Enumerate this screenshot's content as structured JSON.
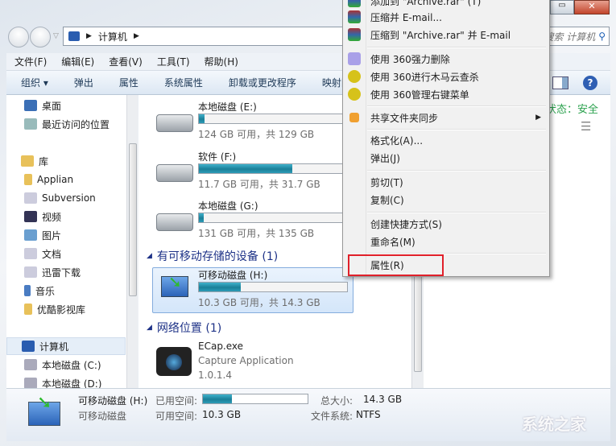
{
  "nav": {
    "breadcrumb": [
      "计算机"
    ],
    "search_placeholder": "搜索 计算机"
  },
  "menubar": [
    "文件(F)",
    "编辑(E)",
    "查看(V)",
    "工具(T)",
    "帮助(H)"
  ],
  "toolbar": [
    "组织 ▾",
    "弹出",
    "属性",
    "系统属性",
    "卸载或更改程序",
    "映射网"
  ],
  "sidebar": {
    "items": [
      {
        "label": "桌面",
        "icon": "desktop-icon"
      },
      {
        "label": "最近访问的位置",
        "icon": "recent-icon"
      },
      {
        "label": "库",
        "icon": "library-icon"
      },
      {
        "label": "Applian",
        "icon": "folder-icon"
      },
      {
        "label": "Subversion",
        "icon": "document-icon"
      },
      {
        "label": "视频",
        "icon": "video-icon"
      },
      {
        "label": "图片",
        "icon": "picture-icon"
      },
      {
        "label": "文档",
        "icon": "document-icon"
      },
      {
        "label": "迅雷下载",
        "icon": "document-icon"
      },
      {
        "label": "音乐",
        "icon": "music-icon"
      },
      {
        "label": "优酷影视库",
        "icon": "folder-icon"
      },
      {
        "label": "计算机",
        "icon": "computer-icon"
      },
      {
        "label": "本地磁盘 (C:)",
        "icon": "drive-icon"
      },
      {
        "label": "本地磁盘 (D:)",
        "icon": "drive-icon"
      }
    ]
  },
  "drives": [
    {
      "name": "本地磁盘 (E:)",
      "info": "124 GB 可用，共 129 GB",
      "used_fraction": 0.04
    },
    {
      "name": "软件 (F:)",
      "info": "11.7 GB 可用，共 31.7 GB",
      "used_fraction": 0.63
    },
    {
      "name": "本地磁盘 (G:)",
      "info": "131 GB 可用，共 135 GB",
      "used_fraction": 0.03
    }
  ],
  "removable_group": "有可移动存储的设备 (1)",
  "removable": {
    "name": "可移动磁盘 (H:)",
    "info": "10.3 GB 可用，共 14.3 GB",
    "used_fraction": 0.28
  },
  "network_group": "网络位置 (1)",
  "network": {
    "name": "ECap.exe",
    "desc": "Capture Application",
    "version": "1.0.1.4"
  },
  "right": {
    "status": "状态：安全"
  },
  "context_menu": {
    "items": [
      "添加到 \"Archive.rar\" (T)",
      "压缩并 E-mail...",
      "压缩到 \"Archive.rar\" 并 E-mail",
      "使用 360强力删除",
      "使用 360进行木马云查杀",
      "使用 360管理右键菜单",
      "共享文件夹同步",
      "格式化(A)...",
      "弹出(J)",
      "剪切(T)",
      "复制(C)",
      "创建快捷方式(S)",
      "重命名(M)",
      "属性(R)"
    ],
    "highlighted": "属性(R)",
    "highlight_color": "#e0202a"
  },
  "details": {
    "name": "可移动磁盘 (H:)",
    "type": "可移动磁盘",
    "used_label": "已用空间:",
    "free_label": "可用空间:",
    "free": "10.3 GB",
    "total_label": "总大小:",
    "total": "14.3 GB",
    "fs_label": "文件系统:",
    "fs": "NTFS",
    "used_fraction": 0.28
  },
  "watermark": "系统之家"
}
